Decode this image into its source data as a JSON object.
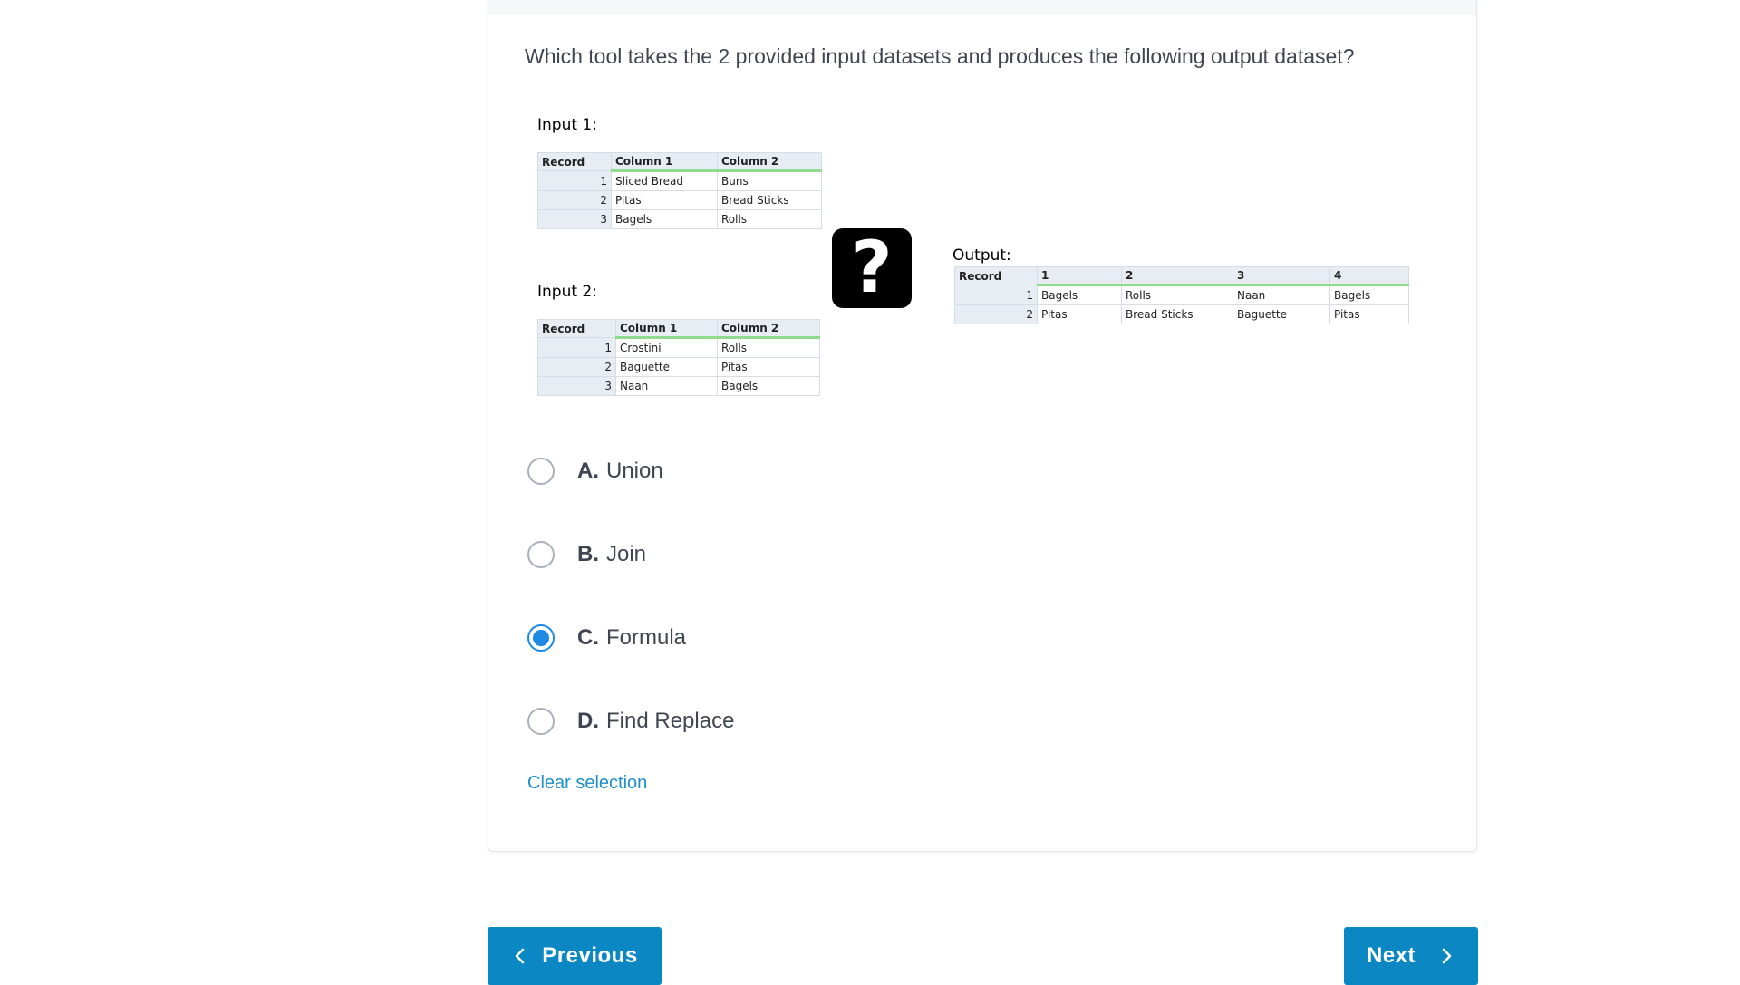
{
  "question": "Which tool takes the 2 provided input datasets and produces the following output dataset?",
  "figure": {
    "input1": {
      "label": "Input 1:",
      "headers": [
        "Record",
        "Column 1",
        "Column 2"
      ],
      "rows": [
        [
          "1",
          "Sliced Bread",
          "Buns"
        ],
        [
          "2",
          "Pitas",
          "Bread Sticks"
        ],
        [
          "3",
          "Bagels",
          "Rolls"
        ]
      ]
    },
    "input2": {
      "label": "Input 2:",
      "headers": [
        "Record",
        "Column 1",
        "Column 2"
      ],
      "rows": [
        [
          "1",
          "Crostini",
          "Rolls"
        ],
        [
          "2",
          "Baguette",
          "Pitas"
        ],
        [
          "3",
          "Naan",
          "Bagels"
        ]
      ]
    },
    "question_mark": "?",
    "output": {
      "label": "Output:",
      "headers": [
        "Record",
        "1",
        "2",
        "3",
        "4"
      ],
      "rows": [
        [
          "1",
          "Bagels",
          "Rolls",
          "Naan",
          "Bagels"
        ],
        [
          "2",
          "Pitas",
          "Bread Sticks",
          "Baguette",
          "Pitas"
        ]
      ]
    }
  },
  "options": [
    {
      "letter": "A.",
      "text": "Union",
      "selected": false
    },
    {
      "letter": "B.",
      "text": "Join",
      "selected": false
    },
    {
      "letter": "C.",
      "text": "Formula",
      "selected": true
    },
    {
      "letter": "D.",
      "text": "Find Replace",
      "selected": false
    }
  ],
  "clear_selection": "Clear selection",
  "nav": {
    "previous": "Previous",
    "next": "Next"
  },
  "colors": {
    "accent": "#1e88e5",
    "button": "#0b87c4",
    "link": "#1f8fc7"
  }
}
